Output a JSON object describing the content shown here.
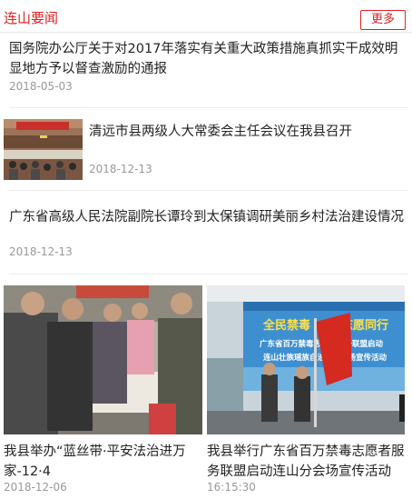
{
  "header": {
    "title": "连山要闻",
    "more_label": "更多"
  },
  "news": [
    {
      "title": "国务院办公厅关于对2017年落实有关重大政策措施真抓实干成效明显地方予以督查激励的通报",
      "date": "2018-05-03"
    },
    {
      "title": "清远市县两级人大常委会主任会议在我县召开",
      "date": "2018-12-13"
    },
    {
      "title": "广东省高级人民法院副院长谭玲到太保镇调研美丽乡村法治建设情况",
      "date": "2018-12-13"
    }
  ],
  "cards": [
    {
      "title": "我县举办“蓝丝带·平安法治进万家-12·4",
      "date": "2018-12-06"
    },
    {
      "title": "我县举行广东省百万禁毒志愿者服务联盟启动连山分会场宣传活动",
      "date": "16:15:30"
    }
  ],
  "banner": {
    "line1_left": "全民禁毒",
    "line1_right": "志愿同行",
    "line2": "广东省百万禁毒志愿者服务联盟启动",
    "line3": "连山壮族瑶族自治县分会场宣传活动"
  },
  "colors": {
    "accent": "#e02020",
    "date": "#999999",
    "divider": "#ececec"
  }
}
